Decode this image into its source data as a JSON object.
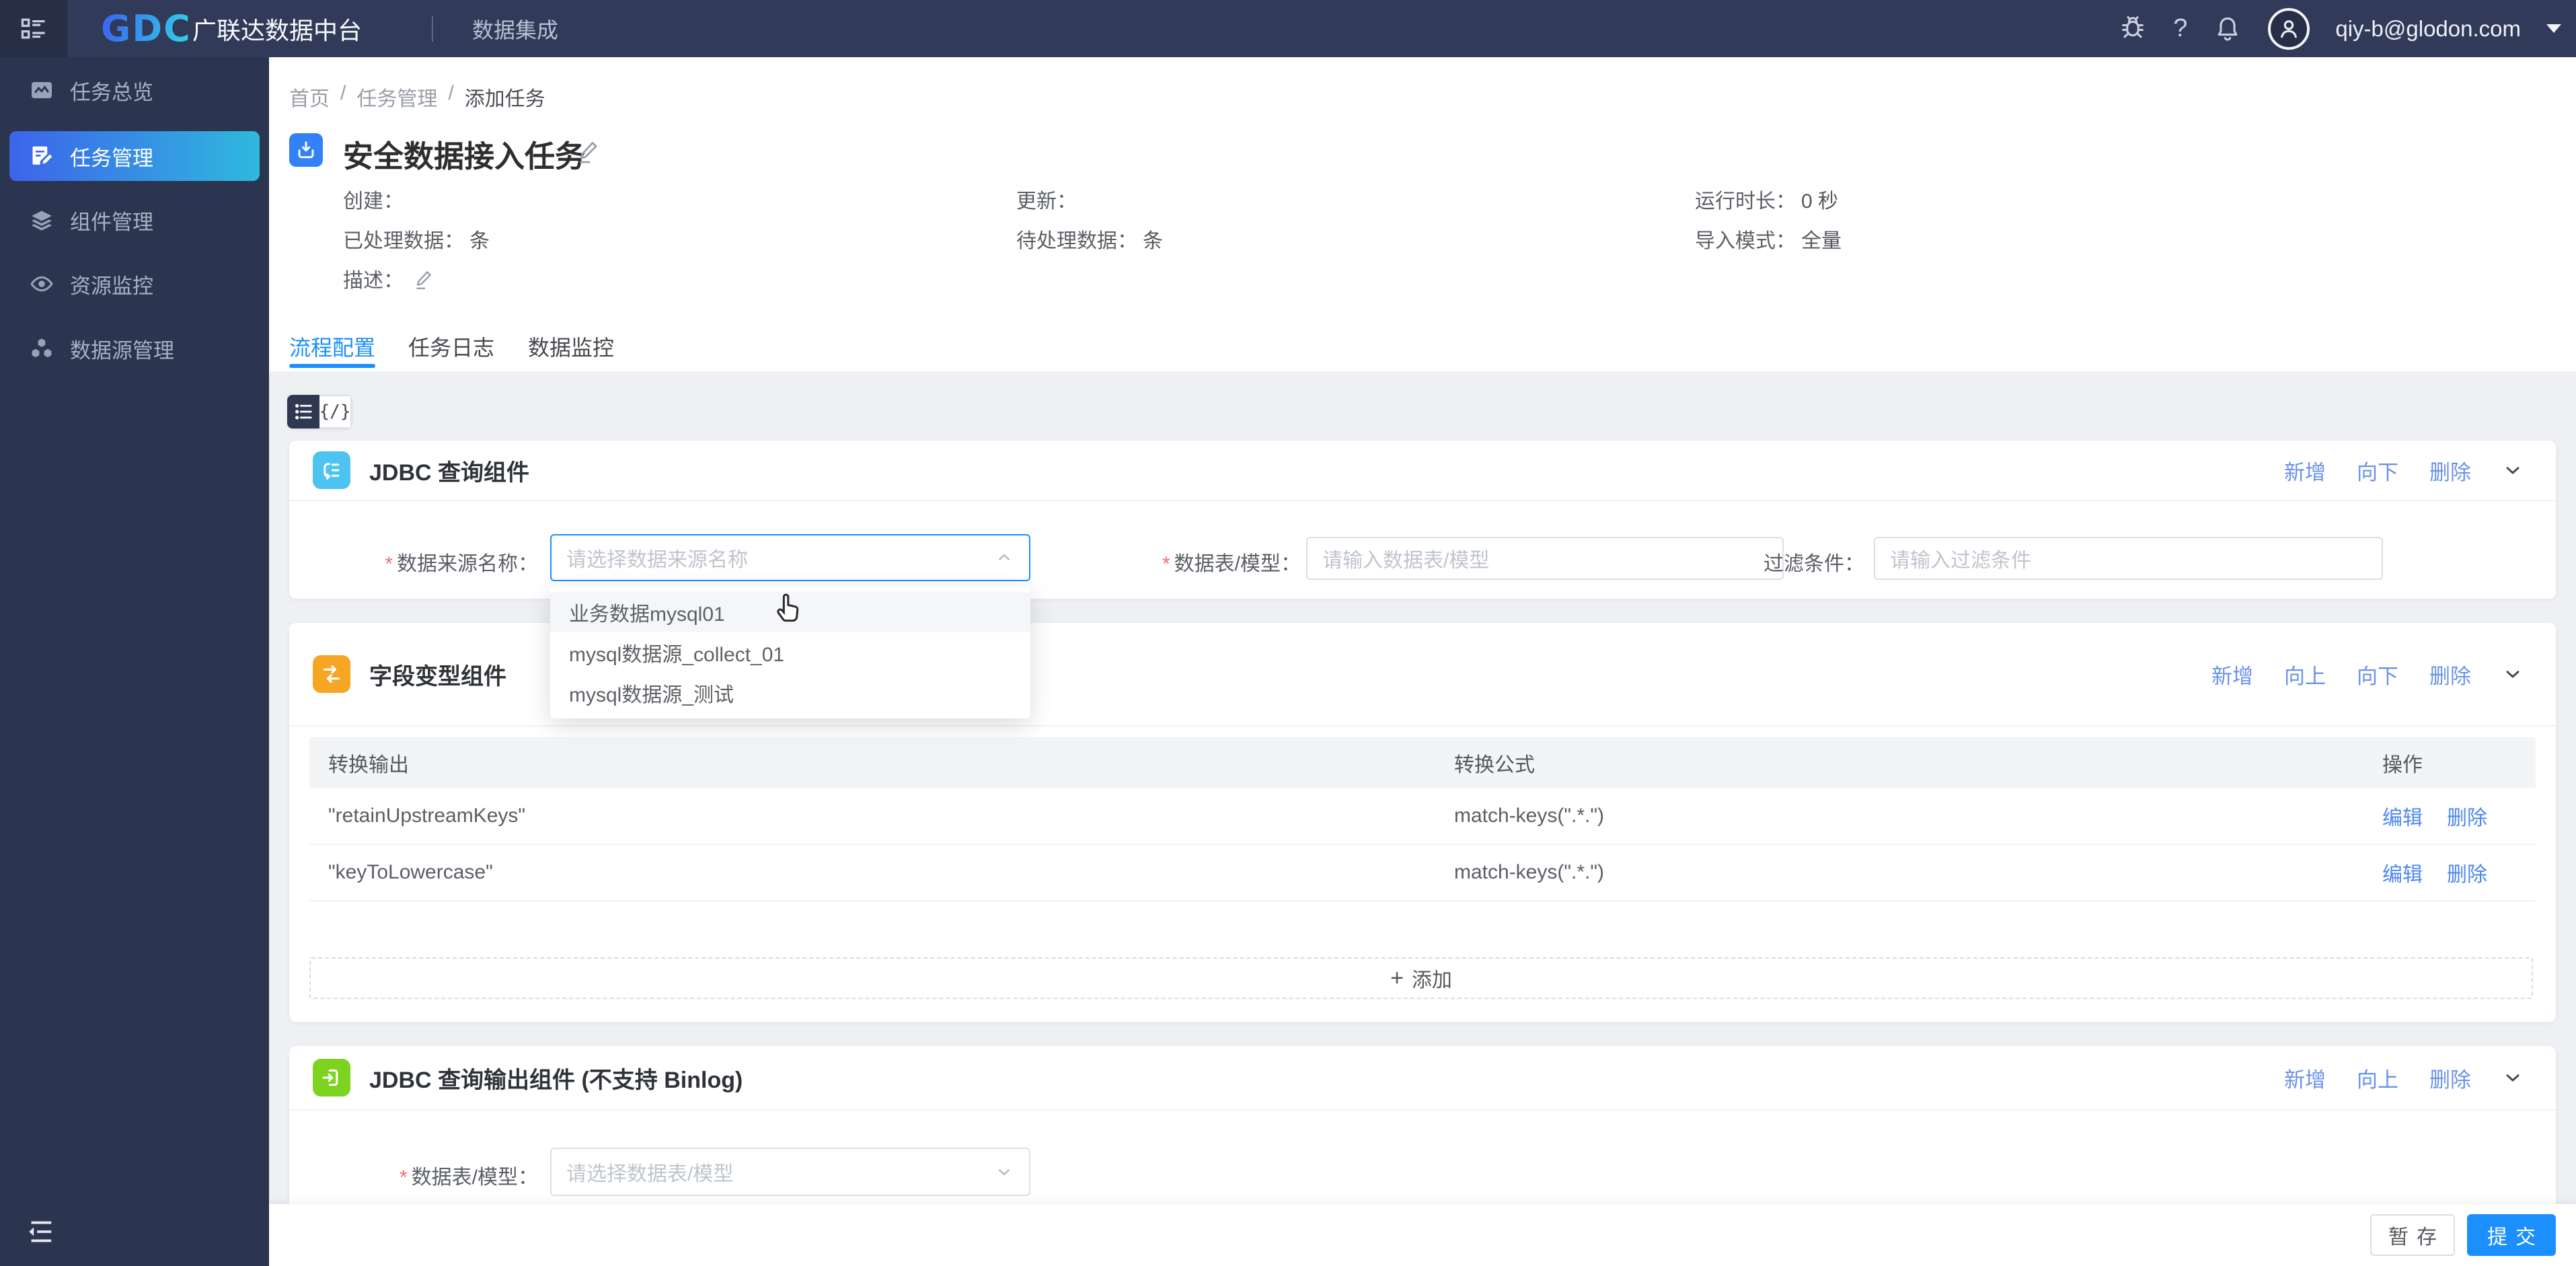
{
  "header": {
    "product_abbr": "GDC",
    "product_name": "广联达数据中台",
    "module_name": "数据集成",
    "help_glyph": "?",
    "user_email": "qiy-b@glodon.com"
  },
  "sidebar": {
    "items": [
      {
        "label": "任务总览"
      },
      {
        "label": "任务管理"
      },
      {
        "label": "组件管理"
      },
      {
        "label": "资源监控"
      },
      {
        "label": "数据源管理"
      }
    ]
  },
  "breadcrumb": {
    "separator": "/",
    "items": [
      "首页",
      "任务管理",
      "添加任务"
    ]
  },
  "task": {
    "title": "安全数据接入任务",
    "created_label": "创建：",
    "updated_label": "更新：",
    "runtime_label": "运行时长：",
    "runtime_value": "0 秒",
    "processed_label": "已处理数据：",
    "processed_value": "条",
    "pending_label": "待处理数据：",
    "pending_value": "条",
    "mode_label": "导入模式：",
    "mode_value": "全量",
    "desc_label": "描述："
  },
  "tabs": [
    {
      "label": "流程配置"
    },
    {
      "label": "任务日志"
    },
    {
      "label": "数据监控"
    }
  ],
  "toolbar": {
    "code_view_label": "{/}"
  },
  "jdbc_query_card": {
    "title": "JDBC 查询组件",
    "actions": [
      "新增",
      "向下",
      "删除"
    ],
    "source_required": "*",
    "source_label": "数据来源名称：",
    "source_placeholder": "请选择数据来源名称",
    "table_required": "*",
    "table_label": "数据表/模型：",
    "table_placeholder": "请输入数据表/模型",
    "filter_label": "过滤条件：",
    "filter_placeholder": "请输入过滤条件"
  },
  "source_dropdown": {
    "options": [
      "业务数据mysql01",
      "mysql数据源_collect_01",
      "mysql数据源_测试"
    ]
  },
  "transform_card": {
    "title": "字段变型组件",
    "actions": [
      "新增",
      "向上",
      "向下",
      "删除"
    ],
    "table": {
      "headers": [
        "转换输出",
        "转换公式",
        "操作"
      ],
      "rows": [
        {
          "output": "\"retainUpstreamKeys\"",
          "formula": "match-keys(\".*.\")",
          "edit": "编辑",
          "delete": "删除"
        },
        {
          "output": "\"keyToLowercase\"",
          "formula": "match-keys(\".*.\")",
          "edit": "编辑",
          "delete": "删除"
        }
      ],
      "add_plus": "+",
      "add_label": "添加"
    }
  },
  "jdbc_output_card": {
    "title": "JDBC 查询输出组件 (不支持 Binlog)",
    "actions": [
      "新增",
      "向上",
      "删除"
    ],
    "table_required": "*",
    "table_label": "数据表/模型：",
    "table_placeholder": "请选择数据表/模型"
  },
  "footer": {
    "save_label": "暂存",
    "submit_label": "提交"
  },
  "colors": {
    "primary": "#1B8FFB",
    "header_bg": "#313A58",
    "sidebar_bg": "#2C354F",
    "sidebar_active_from": "#3D63EA",
    "sidebar_active_to": "#2FB9DE",
    "action_link": "#6A92EA",
    "query_icon": "#4CC3F0",
    "transform_icon": "#F6A623",
    "output_icon": "#7ED321"
  }
}
